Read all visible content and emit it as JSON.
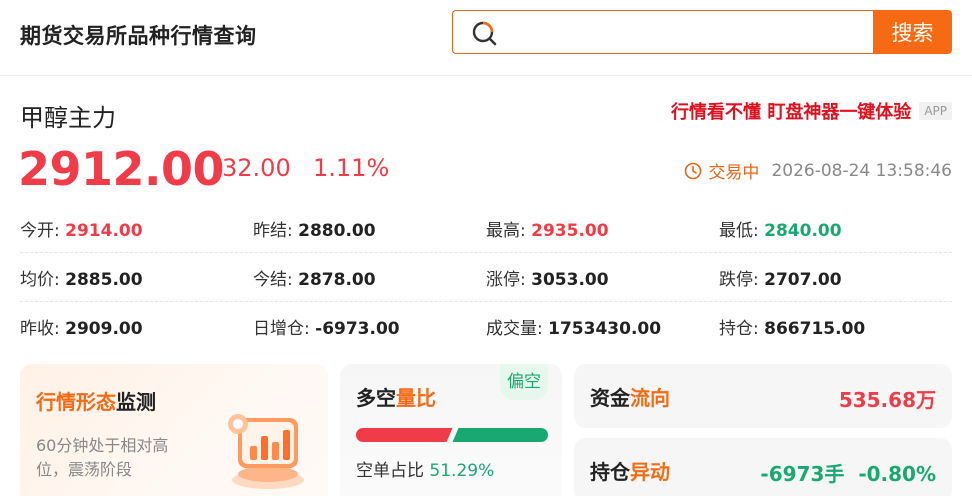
{
  "header": {
    "title": "期货交易所品种行情查询",
    "search_placeholder": "",
    "search_button": "搜索"
  },
  "product": {
    "name": "甲醇主力",
    "price": "2912.00",
    "change": "32.00",
    "change_pct": "1.11%",
    "status": "交易中",
    "datetime": "2026-08-24 13:58:46"
  },
  "promo": {
    "text": "行情看不懂 盯盘神器一键体验",
    "tag": "APP"
  },
  "stats": [
    [
      {
        "label": "今开:",
        "value": "2914.00",
        "color": "red"
      },
      {
        "label": "昨结:",
        "value": "2880.00",
        "color": "normal"
      },
      {
        "label": "最高:",
        "value": "2935.00",
        "color": "red"
      },
      {
        "label": "最低:",
        "value": "2840.00",
        "color": "green"
      }
    ],
    [
      {
        "label": "均价:",
        "value": "2885.00",
        "color": "normal"
      },
      {
        "label": "今结:",
        "value": "2878.00",
        "color": "normal"
      },
      {
        "label": "涨停:",
        "value": "3053.00",
        "color": "normal"
      },
      {
        "label": "跌停:",
        "value": "2707.00",
        "color": "normal"
      }
    ],
    [
      {
        "label": "昨收:",
        "value": "2909.00",
        "color": "normal"
      },
      {
        "label": "日增仓:",
        "value": "-6973.00",
        "color": "normal"
      },
      {
        "label": "成交量:",
        "value": "1753430.00",
        "color": "normal"
      },
      {
        "label": "持仓:",
        "value": "866715.00",
        "color": "normal"
      }
    ]
  ],
  "cards": {
    "trend": {
      "title_main": "行情形态",
      "title_accent": "监测",
      "desc": "60分钟处于相对高位，震荡阶段"
    },
    "longshort": {
      "title_main": "多空",
      "title_accent": "量比",
      "tag": "偏空",
      "text": "空单占比",
      "value": "51.29%",
      "short_ratio": 0.5129
    },
    "fund": {
      "title_main": "资金",
      "title_accent": "流向",
      "value": "535.68万"
    },
    "position": {
      "title_main": "持仓",
      "title_accent": "异动",
      "value": "-6973手",
      "pct": "-0.80%"
    }
  },
  "colors": {
    "up": "#f03c48",
    "down": "#1aa872",
    "accent": "#f56a13"
  }
}
